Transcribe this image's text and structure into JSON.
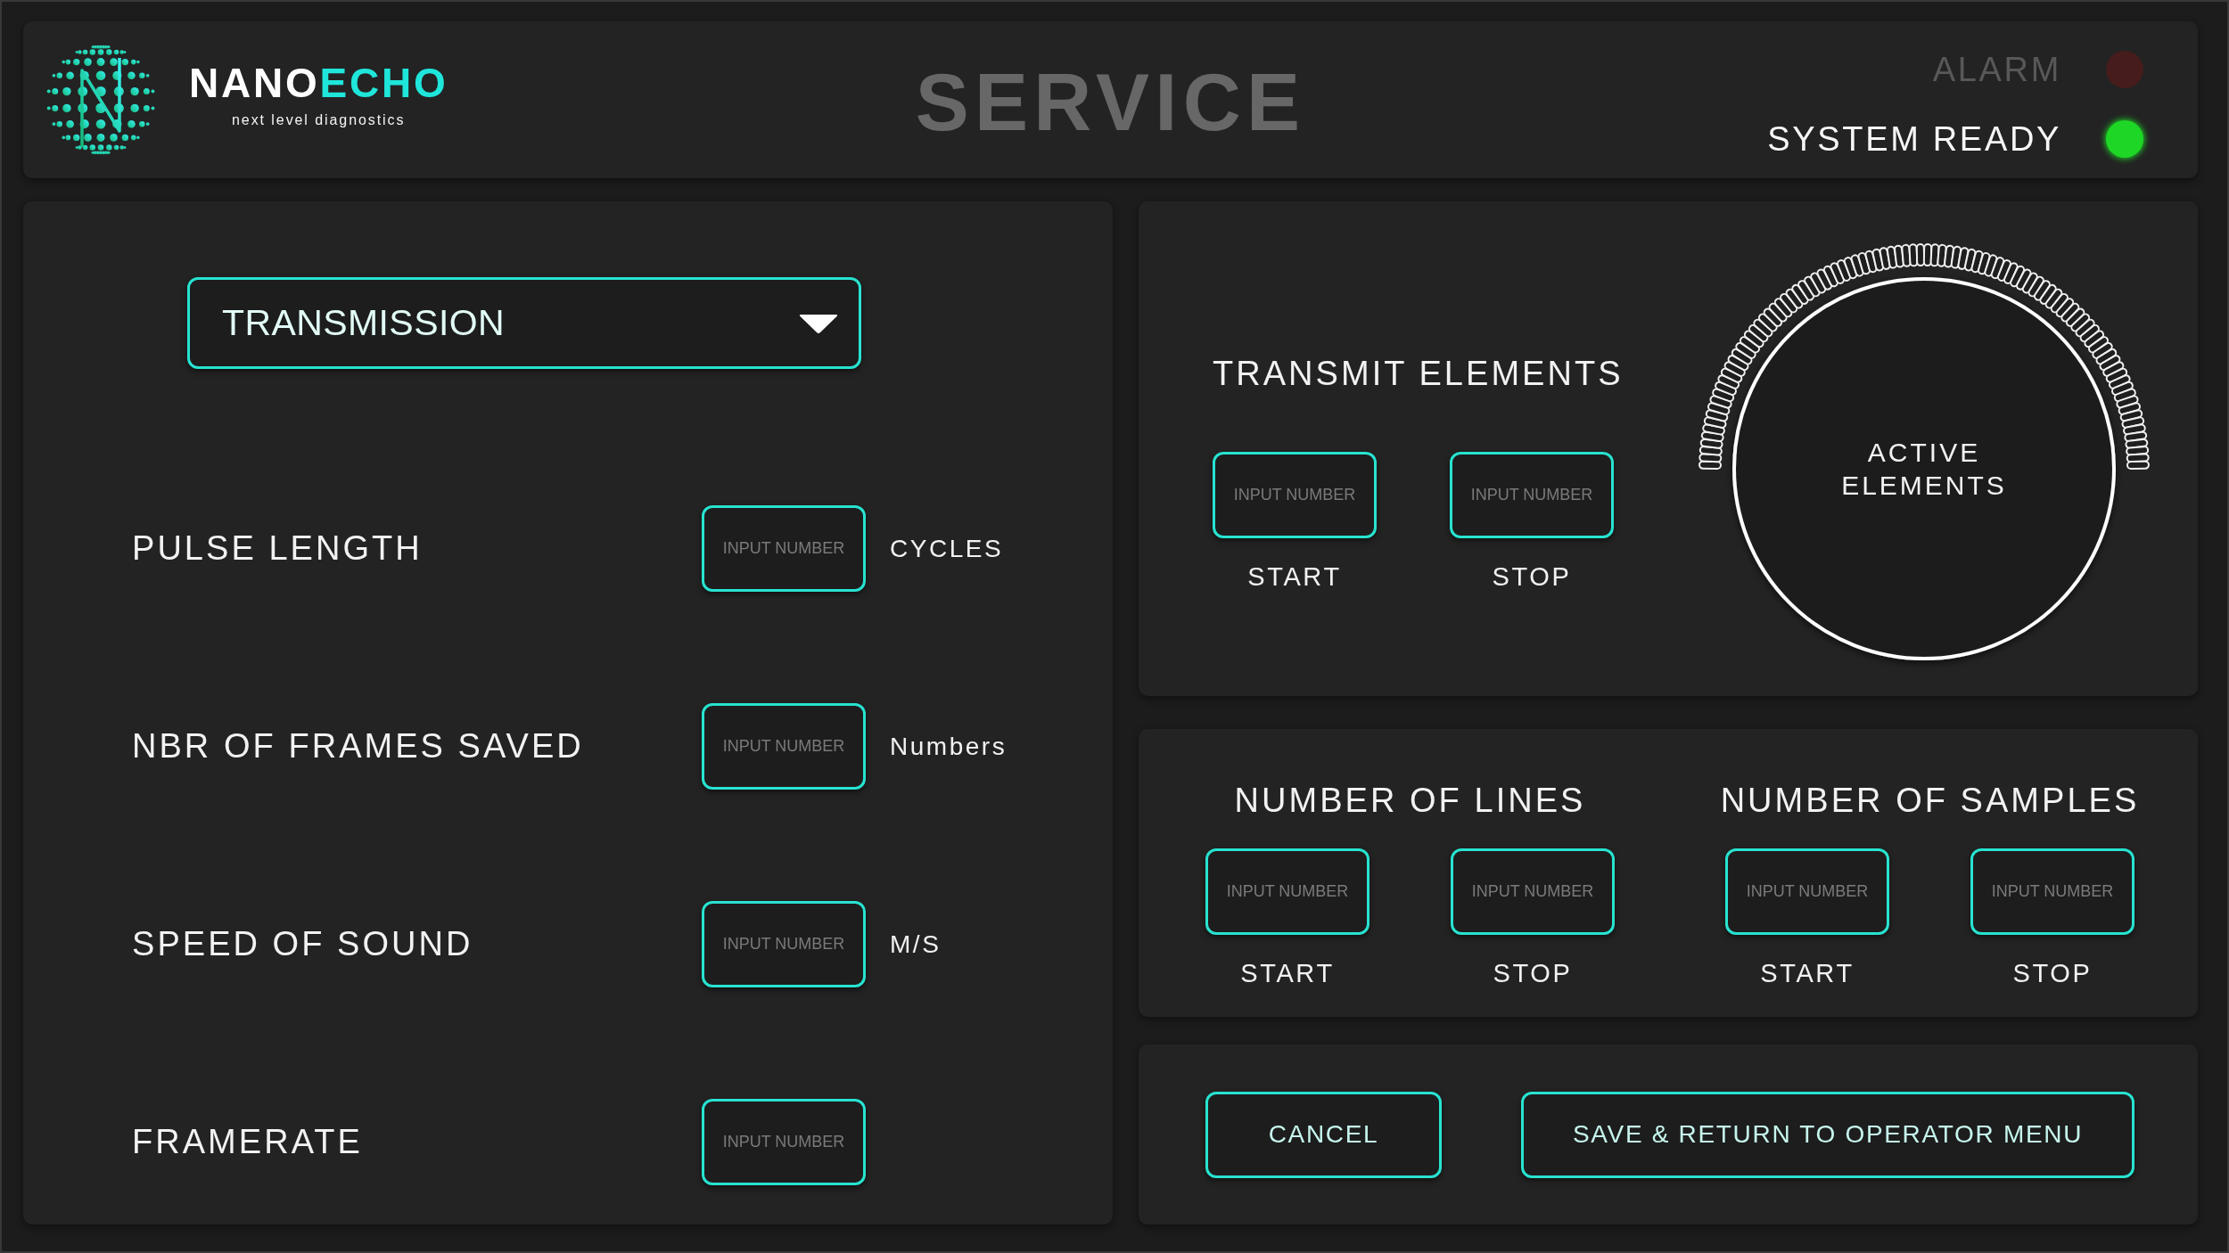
{
  "header": {
    "logo": {
      "name_first": "NANO",
      "name_second": "ECHO",
      "tagline": "next level diagnostics"
    },
    "title": "SERVICE",
    "indicators": [
      {
        "label": "ALARM",
        "on": false,
        "color": "#461c1c"
      },
      {
        "label": "SYSTEM READY",
        "on": true,
        "color": "#1ed626"
      }
    ]
  },
  "settings_panel": {
    "mode_dropdown": {
      "value": "TRANSMISSION"
    },
    "rows": [
      {
        "label": "PULSE LENGTH",
        "input": {
          "placeholder": "INPUT NUMBER"
        },
        "unit": "CYCLES"
      },
      {
        "label": "NBR OF FRAMES SAVED",
        "input": {
          "placeholder": "INPUT NUMBER"
        },
        "unit": "Numbers"
      },
      {
        "label": "SPEED OF SOUND",
        "input": {
          "placeholder": "INPUT NUMBER"
        },
        "unit": "M/S"
      },
      {
        "label": "FRAMERATE",
        "input": {
          "placeholder": "INPUT NUMBER"
        }
      }
    ]
  },
  "transmit_panel": {
    "title": "TRANSMIT ELEMENTS",
    "fields": [
      {
        "placeholder": "INPUT NUMBER",
        "label": "START"
      },
      {
        "placeholder": "INPUT NUMBER",
        "label": "STOP"
      }
    ],
    "dial": {
      "label": "ACTIVE ELEMENTS"
    }
  },
  "range_panel": {
    "groups": [
      {
        "title": "NUMBER OF LINES",
        "fields": [
          {
            "placeholder": "INPUT NUMBER",
            "label": "START"
          },
          {
            "placeholder": "INPUT NUMBER",
            "label": "STOP"
          }
        ]
      },
      {
        "title": "NUMBER OF SAMPLES",
        "fields": [
          {
            "placeholder": "INPUT NUMBER",
            "label": "START"
          },
          {
            "placeholder": "INPUT NUMBER",
            "label": "STOP"
          }
        ]
      }
    ]
  },
  "actions": [
    {
      "label": "CANCEL"
    },
    {
      "label": "SAVE & RETURN TO OPERATOR MENU"
    }
  ]
}
